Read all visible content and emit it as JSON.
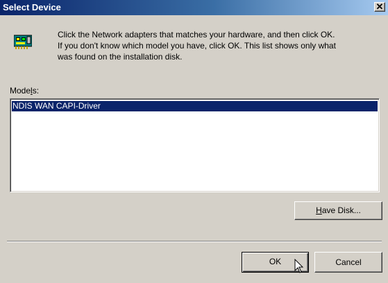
{
  "window": {
    "title": "Select Device",
    "close_glyph": "✕"
  },
  "description": {
    "line1": "Click the Network adapters that matches your hardware, and then click OK.",
    "line2": "If you don't know which model you have, click OK. This list shows only what",
    "line3": "was found on the installation disk.",
    "icon": "network-card-icon"
  },
  "models": {
    "label_pre": "Mode",
    "label_mnemonic": "l",
    "label_post": "s:",
    "items": [
      "NDIS WAN CAPI-Driver"
    ],
    "selected_index": 0
  },
  "buttons": {
    "have_disk_mnemonic": "H",
    "have_disk_rest": "ave Disk...",
    "ok": "OK",
    "cancel": "Cancel"
  },
  "colors": {
    "titlebar_start": "#0a246a",
    "titlebar_end": "#a6caf0",
    "selection": "#0a246a",
    "face": "#d4d0c8"
  }
}
